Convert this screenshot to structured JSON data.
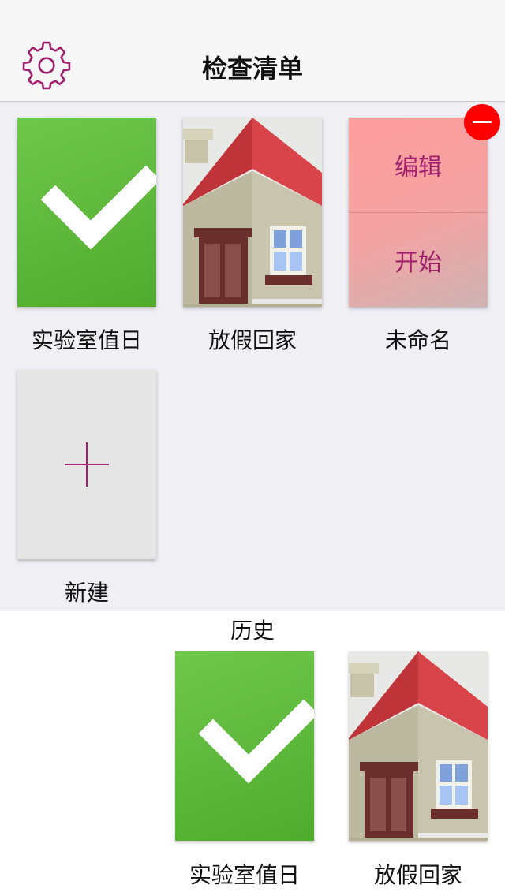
{
  "header": {
    "title": "检查清单",
    "settings_icon": "gear-icon"
  },
  "colors": {
    "accent": "#a0206e",
    "delete": "#ff0000",
    "green": "#5cb83a"
  },
  "checklists": [
    {
      "label": "实验室值日",
      "icon": "checkmark-icon"
    },
    {
      "label": "放假回家",
      "icon": "house-icon"
    },
    {
      "label": "未命名",
      "edit_label": "编辑",
      "start_label": "开始"
    }
  ],
  "new_item": {
    "label": "新建",
    "icon": "plus-icon"
  },
  "history": {
    "title": "历史",
    "items": [
      {
        "label": "实验室值日",
        "icon": "checkmark-icon"
      },
      {
        "label": "放假回家",
        "icon": "house-icon"
      }
    ]
  }
}
